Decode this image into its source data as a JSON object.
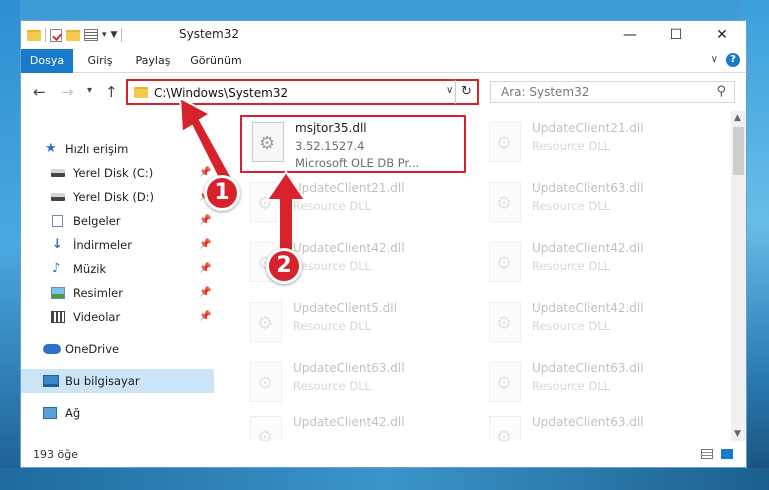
{
  "window": {
    "title": "System32"
  },
  "ribbon": {
    "tabs": [
      "Dosya",
      "Giriş",
      "Paylaş",
      "Görünüm"
    ]
  },
  "navigation": {
    "address": "C:\\Windows\\System32",
    "search_placeholder": "Ara: System32"
  },
  "sidebar": {
    "items": [
      {
        "label": "Hızlı erişim",
        "icon": "star-icon"
      },
      {
        "label": "Yerel Disk (C:)",
        "icon": "disk-icon"
      },
      {
        "label": "Yerel Disk (D:)",
        "icon": "disk-icon"
      },
      {
        "label": "Belgeler",
        "icon": "documents-icon"
      },
      {
        "label": "İndirmeler",
        "icon": "download-icon"
      },
      {
        "label": "Müzik",
        "icon": "music-icon"
      },
      {
        "label": "Resimler",
        "icon": "pictures-icon"
      },
      {
        "label": "Videolar",
        "icon": "videos-icon"
      },
      {
        "label": "OneDrive",
        "icon": "cloud-icon"
      },
      {
        "label": "Bu bilgisayar",
        "icon": "computer-icon"
      },
      {
        "label": "Ağ",
        "icon": "network-icon"
      }
    ]
  },
  "files": [
    {
      "name": "msjtor35.dll",
      "version": "3.52.1527.4",
      "description": "Microsoft OLE DB Pr..."
    },
    {
      "name": "UpdateClient21.dll",
      "description": "Resource DLL"
    },
    {
      "name": "UpdateClient21.dll",
      "description": "Resource DLL"
    },
    {
      "name": "UpdateClient63.dll",
      "description": "Resource DLL"
    },
    {
      "name": "UpdateClient42.dll",
      "description": "Resource DLL"
    },
    {
      "name": "UpdateClient42.dll",
      "description": "Resource DLL"
    },
    {
      "name": "UpdateClient5.dll",
      "description": "Resource DLL"
    },
    {
      "name": "UpdateClient42.dll",
      "description": "Resource DLL"
    },
    {
      "name": "UpdateClient42.dll",
      "description": "Resource DLL"
    },
    {
      "name": "UpdateClient63.dll",
      "description": "Resource DLL"
    },
    {
      "name": "UpdateClient63.dll",
      "description": "Resource DLL"
    },
    {
      "name": "UpdateClient63.dll",
      "description": "Resource DLL"
    }
  ],
  "status": {
    "item_count": "193 öğe"
  },
  "annotations": {
    "step1": "1",
    "step2": "2"
  },
  "colors": {
    "accent": "#1979ca",
    "highlight": "#d8222b",
    "selection": "#cce4f7"
  }
}
